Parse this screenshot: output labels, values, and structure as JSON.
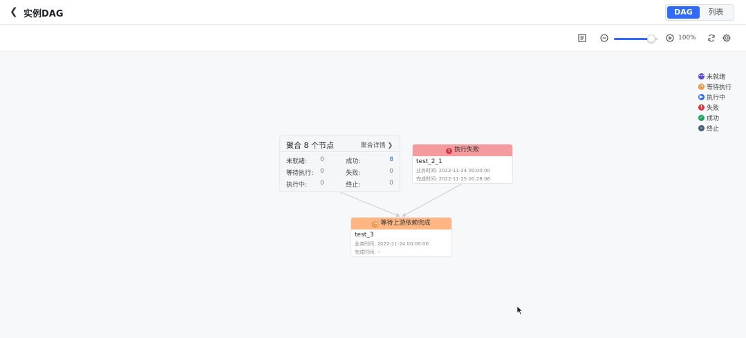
{
  "header": {
    "title": "实例DAG",
    "views": [
      "DAG",
      "列表"
    ],
    "active_view": "DAG"
  },
  "toolbar": {
    "zoom_label": "100%",
    "zoom_value": 0.85
  },
  "legend": [
    {
      "label": "未就绪",
      "color": "#5b4fd6",
      "icon": "dots"
    },
    {
      "label": "等待执行",
      "color": "#f08c3a",
      "icon": "clock"
    },
    {
      "label": "执行中",
      "color": "#2f6bff",
      "icon": "play"
    },
    {
      "label": "失败",
      "color": "#e0333b",
      "icon": "exclamation"
    },
    {
      "label": "成功",
      "color": "#1aa35c",
      "icon": "check"
    },
    {
      "label": "终止",
      "color": "#4a5a7a",
      "icon": "minus"
    }
  ],
  "aggregate": {
    "title": "聚合 8 个节点",
    "detail_link": "聚合详情",
    "rows": [
      {
        "l1": "未就绪:",
        "v1": "0",
        "l2": "成功:",
        "v2": "8"
      },
      {
        "l1": "等待执行:",
        "v1": "0",
        "l2": "失败:",
        "v2": "0"
      },
      {
        "l1": "执行中:",
        "v1": "0",
        "l2": "终止:",
        "v2": "0"
      }
    ]
  },
  "nodes": {
    "fail": {
      "status": "执行失败",
      "name": "test_2_1",
      "biz_time": "业务时间: 2022-11-24 00:00:00",
      "done_time": "完成时间: 2022-11-25 00:28:06"
    },
    "wait": {
      "status": "等待上游依赖完成",
      "name": "test_3",
      "biz_time": "业务时间: 2022-11-24 00:00:00",
      "done_time": "完成时间: --"
    }
  }
}
